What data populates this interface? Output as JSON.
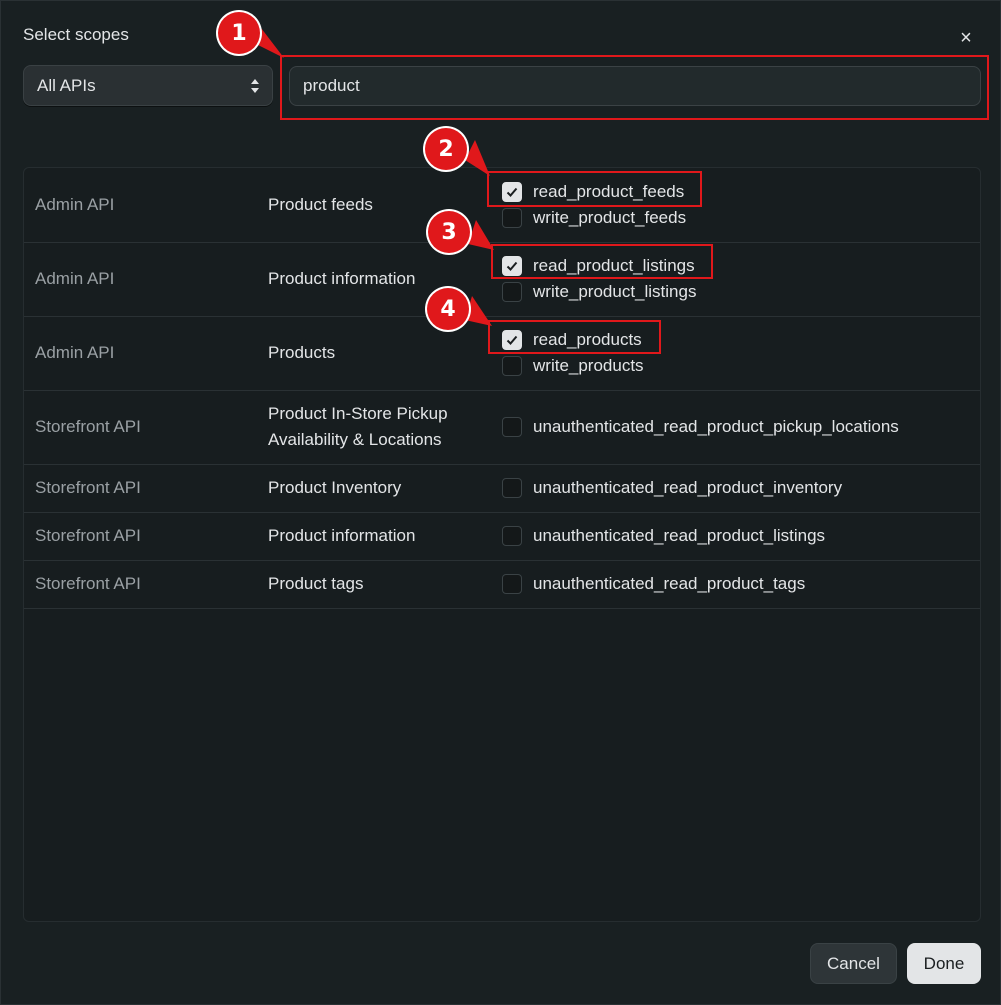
{
  "dialog": {
    "title": "Select scopes",
    "close_label": "×"
  },
  "filter": {
    "selected": "All APIs"
  },
  "search": {
    "value": "product"
  },
  "rows": [
    {
      "api": "Admin API",
      "resource": "Product feeds",
      "scopes": [
        {
          "label": "read_product_feeds",
          "checked": true
        },
        {
          "label": "write_product_feeds",
          "checked": false
        }
      ]
    },
    {
      "api": "Admin API",
      "resource": "Product information",
      "scopes": [
        {
          "label": "read_product_listings",
          "checked": true
        },
        {
          "label": "write_product_listings",
          "checked": false
        }
      ]
    },
    {
      "api": "Admin API",
      "resource": "Products",
      "scopes": [
        {
          "label": "read_products",
          "checked": true
        },
        {
          "label": "write_products",
          "checked": false
        }
      ]
    },
    {
      "api": "Storefront API",
      "resource_line1": "Product In-Store Pickup",
      "resource_line2": "Availability & Locations",
      "scopes": [
        {
          "label": "unauthenticated_read_product_pickup_locations",
          "checked": false
        }
      ]
    },
    {
      "api": "Storefront API",
      "resource": "Product Inventory",
      "scopes": [
        {
          "label": "unauthenticated_read_product_inventory",
          "checked": false
        }
      ]
    },
    {
      "api": "Storefront API",
      "resource": "Product information",
      "scopes": [
        {
          "label": "unauthenticated_read_product_listings",
          "checked": false
        }
      ]
    },
    {
      "api": "Storefront API",
      "resource": "Product tags",
      "scopes": [
        {
          "label": "unauthenticated_read_product_tags",
          "checked": false
        }
      ]
    }
  ],
  "footer": {
    "cancel_label": "Cancel",
    "done_label": "Done"
  },
  "annotations": [
    "1",
    "2",
    "3",
    "4"
  ],
  "colors": {
    "background": "#192022",
    "annotation_red": "#e0181b",
    "text": "#e3e5e7",
    "muted_text": "#9aa0a4"
  }
}
